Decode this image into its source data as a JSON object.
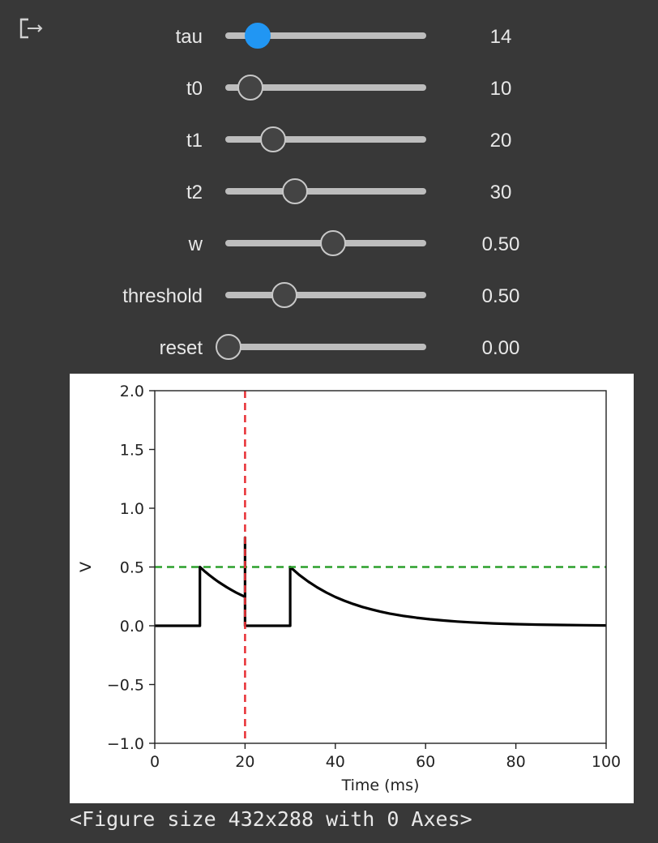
{
  "output_icon": "output-redirect-icon",
  "sliders": [
    {
      "label": "tau",
      "value": "14",
      "fraction": 0.145,
      "active": true
    },
    {
      "label": "t0",
      "value": "10",
      "fraction": 0.11,
      "active": false
    },
    {
      "label": "t1",
      "value": "20",
      "fraction": 0.22,
      "active": false
    },
    {
      "label": "t2",
      "value": "30",
      "fraction": 0.33,
      "active": false
    },
    {
      "label": "w",
      "value": "0.50",
      "fraction": 0.52,
      "active": false
    },
    {
      "label": "threshold",
      "value": "0.50",
      "fraction": 0.28,
      "active": false
    },
    {
      "label": "reset",
      "value": "0.00",
      "fraction": 0.0,
      "active": false
    }
  ],
  "colors": {
    "active_thumb": "#2196f3",
    "voltage_line": "#000000",
    "threshold_line": "#2ca02c",
    "spike_line": "#e8353a"
  },
  "chart_data": {
    "type": "line",
    "xlabel": "Time (ms)",
    "ylabel": "V",
    "xlim": [
      0,
      100
    ],
    "ylim": [
      -1.0,
      2.0
    ],
    "x_ticks": [
      "0",
      "20",
      "40",
      "60",
      "80",
      "100"
    ],
    "y_ticks": [
      "2.0",
      "1.5",
      "1.0",
      "0.5",
      "0.0",
      "−0.5",
      "−1.0"
    ],
    "series": [
      {
        "type": "line",
        "x": [
          0,
          10,
          10,
          11,
          12,
          13,
          14,
          15,
          16,
          17,
          18,
          19,
          20,
          20,
          20,
          20,
          30,
          30,
          32,
          34,
          36,
          38,
          40,
          42,
          44,
          46,
          48,
          50,
          52,
          55,
          58,
          61,
          64,
          67,
          70,
          75,
          80,
          85,
          90,
          95,
          100
        ],
        "y": [
          0,
          0,
          0.5,
          0.465,
          0.434,
          0.404,
          0.376,
          0.351,
          0.327,
          0.304,
          0.283,
          0.264,
          0.246,
          0.75,
          0.0,
          0.0,
          0.0,
          0.5,
          0.433,
          0.376,
          0.326,
          0.283,
          0.245,
          0.213,
          0.185,
          0.16,
          0.139,
          0.12,
          0.104,
          0.084,
          0.068,
          0.055,
          0.045,
          0.036,
          0.029,
          0.02,
          0.014,
          0.01,
          0.007,
          0.005,
          0.003
        ]
      }
    ],
    "threshold": 0.5,
    "spike_times": [
      20
    ]
  },
  "caption": "<Figure size 432x288 with 0 Axes>"
}
